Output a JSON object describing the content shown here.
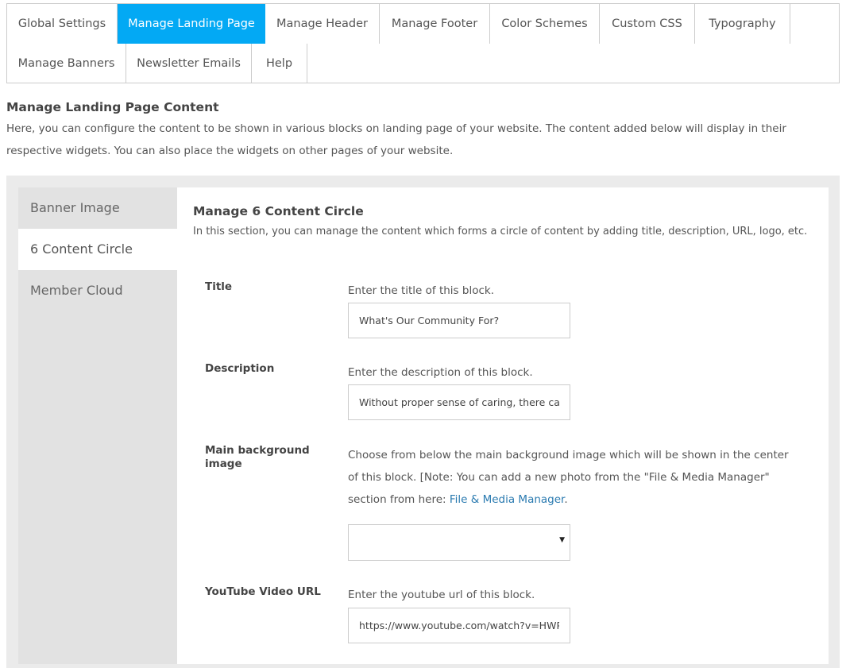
{
  "tabs": [
    {
      "label": "Global Settings",
      "active": false
    },
    {
      "label": "Manage Landing Page",
      "active": true
    },
    {
      "label": "Manage Header",
      "active": false
    },
    {
      "label": "Manage Footer",
      "active": false
    },
    {
      "label": "Color Schemes",
      "active": false
    },
    {
      "label": "Custom CSS",
      "active": false
    },
    {
      "label": "Typography",
      "active": false
    },
    {
      "label": "Manage Banners",
      "active": false
    },
    {
      "label": "Newsletter Emails",
      "active": false
    },
    {
      "label": "Help",
      "active": false
    }
  ],
  "intro": {
    "title": "Manage Landing Page Content",
    "text": "Here, you can configure the content to be shown in various blocks on landing page of your website. The content added below will display in their respective widgets. You can also place the widgets on other pages of your website."
  },
  "sidenav": {
    "items": [
      {
        "label": "Banner Image",
        "active": false
      },
      {
        "label": "6 Content Circle",
        "active": true
      },
      {
        "label": "Member Cloud",
        "active": false
      }
    ]
  },
  "section": {
    "title": "Manage 6 Content Circle",
    "description": "In this section, you can manage the content which forms a circle of content by adding title, description, URL, logo, etc."
  },
  "fields": {
    "title": {
      "label": "Title",
      "help": "Enter the title of this block.",
      "value": "What's Our Community For?"
    },
    "description": {
      "label": "Description",
      "help": "Enter the description of this block.",
      "value": "Without proper sense of caring, there can be"
    },
    "background": {
      "label": "Main background image",
      "help_before": "Choose from below the main background image which will be shown in the center of this block. [Note: You can add a new photo from the \"File & Media Manager\" section from here: ",
      "link_text": "File & Media Manager",
      "help_after": ".",
      "selected": "",
      "arrow": "▼"
    },
    "youtube": {
      "label": "YouTube Video URL",
      "help": "Enter the youtube url of this block.",
      "value": "https://www.youtube.com/watch?v=HWPm"
    }
  },
  "colors": {
    "accent": "#03a9f4",
    "link": "#2a7ab0",
    "wrapper_bg": "#ebebeb",
    "sidenav_bg": "#e2e2e2",
    "border": "#cccccc"
  }
}
